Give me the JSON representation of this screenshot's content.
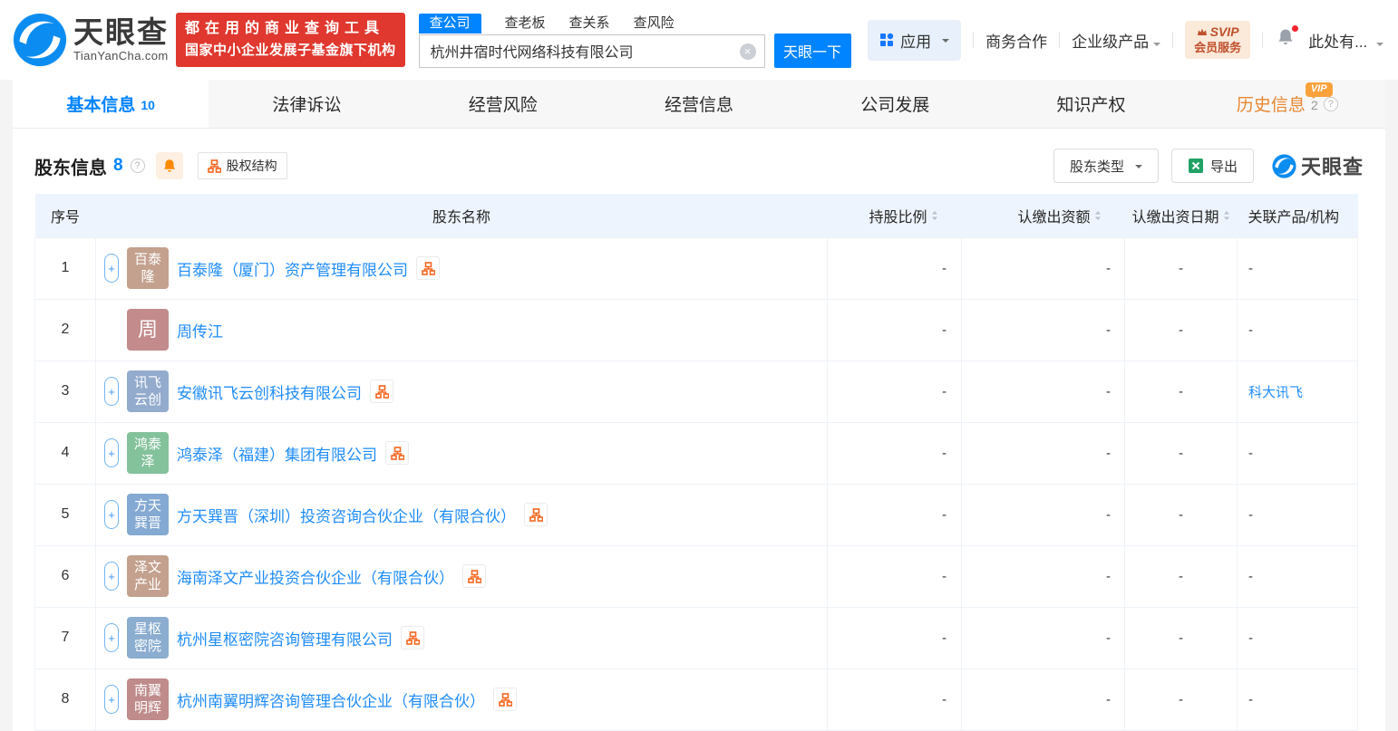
{
  "colors": {
    "brand_blue": "#0084ff",
    "link_blue": "#1f8cf8",
    "slogan_red": "#e0382e",
    "vip_orange": "#f9a23c",
    "history_tab_orange": "#e8872f",
    "excel_green": "#21a366",
    "org_icon_orange": "#f4661e",
    "table_header_bg": "#edf4fd"
  },
  "header": {
    "logo": {
      "name": "天眼查",
      "domain": "TianYanCha.com"
    },
    "slogan": {
      "line1": "都在用的商业查询工具",
      "line2": "国家中小企业发展子基金旗下机构"
    },
    "search": {
      "tabs": [
        {
          "label": "查公司",
          "active": true
        },
        {
          "label": "查老板",
          "active": false
        },
        {
          "label": "查关系",
          "active": false
        },
        {
          "label": "查风险",
          "active": false
        }
      ],
      "value": "杭州井宿时代网络科技有限公司",
      "clear_icon": "×",
      "button": "天眼一下"
    },
    "nav": {
      "apps": "应用",
      "cooperation": "商务合作",
      "enterprise": "企业级产品",
      "svip_line1": "SVIP",
      "svip_line2": "会员服务",
      "user": "此处有..."
    }
  },
  "tabs": [
    {
      "label": "基本信息",
      "count": "10",
      "active": true
    },
    {
      "label": "法律诉讼"
    },
    {
      "label": "经营风险"
    },
    {
      "label": "经营信息"
    },
    {
      "label": "公司发展"
    },
    {
      "label": "知识产权"
    },
    {
      "label": "历史信息",
      "count": "2",
      "vip": true,
      "vip_label": "VIP",
      "help": "?"
    }
  ],
  "section": {
    "title": "股东信息",
    "count": "8",
    "help": "?",
    "equity_structure": "股权结构",
    "shareholder_type": "股东类型",
    "export": "导出",
    "watermark": "天眼查"
  },
  "table": {
    "headers": [
      "序号",
      "股东名称",
      "持股比例",
      "认缴出资额",
      "认缴出资日期",
      "关联产品/机构"
    ],
    "sortable_headers": [
      "持股比例",
      "认缴出资额",
      "认缴出资日期"
    ],
    "rows": [
      {
        "no": "1",
        "avatar_lines": [
          "百泰",
          "隆"
        ],
        "avatar_color": "#c3a18e",
        "name": "百泰隆（厦门）资产管理有限公司",
        "expand": true,
        "chart": true,
        "ratio": "-",
        "amount": "-",
        "date": "-",
        "related": "-",
        "related_link": false
      },
      {
        "no": "2",
        "avatar_lines": [
          "周"
        ],
        "avatar_color": "#c38b8b",
        "name": "周传江",
        "expand": false,
        "chart": false,
        "ratio": "-",
        "amount": "-",
        "date": "-",
        "related": "-",
        "related_link": false
      },
      {
        "no": "3",
        "avatar_lines": [
          "讯飞",
          "云创"
        ],
        "avatar_color": "#93abcd",
        "name": "安徽讯飞云创科技有限公司",
        "expand": true,
        "chart": true,
        "ratio": "-",
        "amount": "-",
        "date": "-",
        "related": "科大讯飞",
        "related_link": true
      },
      {
        "no": "4",
        "avatar_lines": [
          "鸿泰",
          "泽"
        ],
        "avatar_color": "#84c29c",
        "name": "鸿泰泽（福建）集团有限公司",
        "expand": true,
        "chart": true,
        "ratio": "-",
        "amount": "-",
        "date": "-",
        "related": "-",
        "related_link": false
      },
      {
        "no": "5",
        "avatar_lines": [
          "方天",
          "巽晋"
        ],
        "avatar_color": "#84a9d2",
        "name": "方天巽晋（深圳）投资咨询合伙企业（有限合伙）",
        "expand": true,
        "chart": true,
        "ratio": "-",
        "amount": "-",
        "date": "-",
        "related": "-",
        "related_link": false
      },
      {
        "no": "6",
        "avatar_lines": [
          "泽文",
          "产业"
        ],
        "avatar_color": "#c3a18e",
        "name": "海南泽文产业投资合伙企业（有限合伙）",
        "expand": true,
        "chart": true,
        "ratio": "-",
        "amount": "-",
        "date": "-",
        "related": "-",
        "related_link": false
      },
      {
        "no": "7",
        "avatar_lines": [
          "星枢",
          "密院"
        ],
        "avatar_color": "#8badcf",
        "name": "杭州星枢密院咨询管理有限公司",
        "expand": true,
        "chart": true,
        "ratio": "-",
        "amount": "-",
        "date": "-",
        "related": "-",
        "related_link": false
      },
      {
        "no": "8",
        "avatar_lines": [
          "南翼",
          "明辉"
        ],
        "avatar_color": "#bf8b8b",
        "name": "杭州南翼明辉咨询管理合伙企业（有限合伙）",
        "expand": true,
        "chart": true,
        "ratio": "-",
        "amount": "-",
        "date": "-",
        "related": "-",
        "related_link": false
      }
    ]
  }
}
